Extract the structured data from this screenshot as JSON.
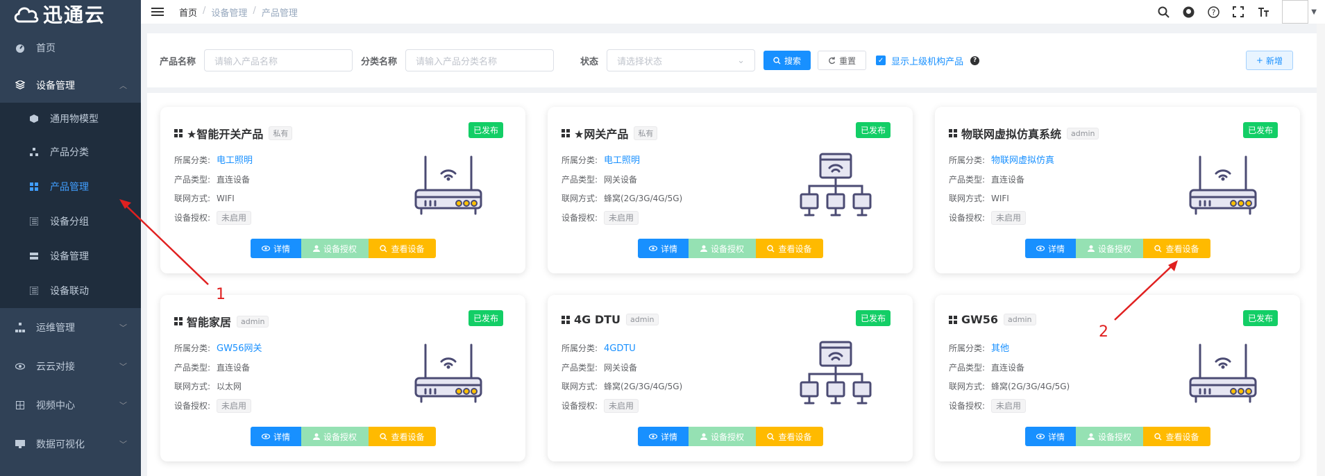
{
  "app": {
    "logo": "迅通云"
  },
  "sidebar": {
    "items": [
      {
        "label": "首页",
        "icon": "dashboard-icon"
      },
      {
        "label": "设备管理",
        "icon": "device-icon",
        "open": true,
        "children": [
          {
            "label": "通用物模型",
            "icon": "cube-icon"
          },
          {
            "label": "产品分类",
            "icon": "tree-icon"
          },
          {
            "label": "产品管理",
            "icon": "grid-icon",
            "active": true
          },
          {
            "label": "设备分组",
            "icon": "list-icon"
          },
          {
            "label": "设备管理",
            "icon": "server-icon"
          },
          {
            "label": "设备联动",
            "icon": "list-icon"
          }
        ]
      },
      {
        "label": "运维管理",
        "icon": "tree-icon"
      },
      {
        "label": "云云对接",
        "icon": "eye-icon"
      },
      {
        "label": "视频中心",
        "icon": "grid-icon"
      },
      {
        "label": "数据可视化",
        "icon": "monitor-icon"
      }
    ]
  },
  "header": {
    "breadcrumb": [
      "首页",
      "设备管理",
      "产品管理"
    ]
  },
  "search": {
    "product_name_label": "产品名称",
    "product_name_placeholder": "请输入产品名称",
    "category_label": "分类名称",
    "category_placeholder": "请输入产品分类名称",
    "status_label": "状态",
    "status_placeholder": "请选择状态",
    "search_btn": "搜索",
    "reset_btn": "重置",
    "show_parent_label": "显示上级机构产品",
    "add_btn": "新增"
  },
  "card_labels": {
    "category": "所属分类:",
    "type": "产品类型:",
    "network": "联网方式:",
    "auth": "设备授权:",
    "detail_btn": "详情",
    "auth_btn": "设备授权",
    "view_btn": "查看设备"
  },
  "products": [
    {
      "name": "★智能开关产品",
      "tag": "私有",
      "status": "已发布",
      "category": "电工照明",
      "type": "直连设备",
      "network": "WIFI",
      "auth": "未启用",
      "illus": "router"
    },
    {
      "name": "★网关产品",
      "tag": "私有",
      "status": "已发布",
      "category": "电工照明",
      "type": "网关设备",
      "network": "蜂窝(2G/3G/4G/5G)",
      "auth": "未启用",
      "illus": "gateway"
    },
    {
      "name": "物联网虚拟仿真系统",
      "tag": "admin",
      "status": "已发布",
      "category": "物联网虚拟仿真",
      "type": "直连设备",
      "network": "WIFI",
      "auth": "未启用",
      "illus": "router"
    },
    {
      "name": "智能家居",
      "tag": "admin",
      "status": "已发布",
      "category": "GW56网关",
      "type": "直连设备",
      "network": "以太网",
      "auth": "未启用",
      "illus": "router"
    },
    {
      "name": "4G DTU",
      "tag": "admin",
      "status": "已发布",
      "category": "4GDTU",
      "type": "网关设备",
      "network": "蜂窝(2G/3G/4G/5G)",
      "auth": "未启用",
      "illus": "gateway"
    },
    {
      "name": "GW56",
      "tag": "admin",
      "status": "已发布",
      "category": "其他",
      "type": "直连设备",
      "network": "蜂窝(2G/3G/4G/5G)",
      "auth": "未启用",
      "illus": "router"
    }
  ],
  "annotations": [
    "1",
    "2"
  ],
  "colors": {
    "primary": "#1890ff",
    "sidebar": "#304156",
    "success": "#13ce66",
    "warning": "#ffba00",
    "annotation": "#e02020"
  }
}
